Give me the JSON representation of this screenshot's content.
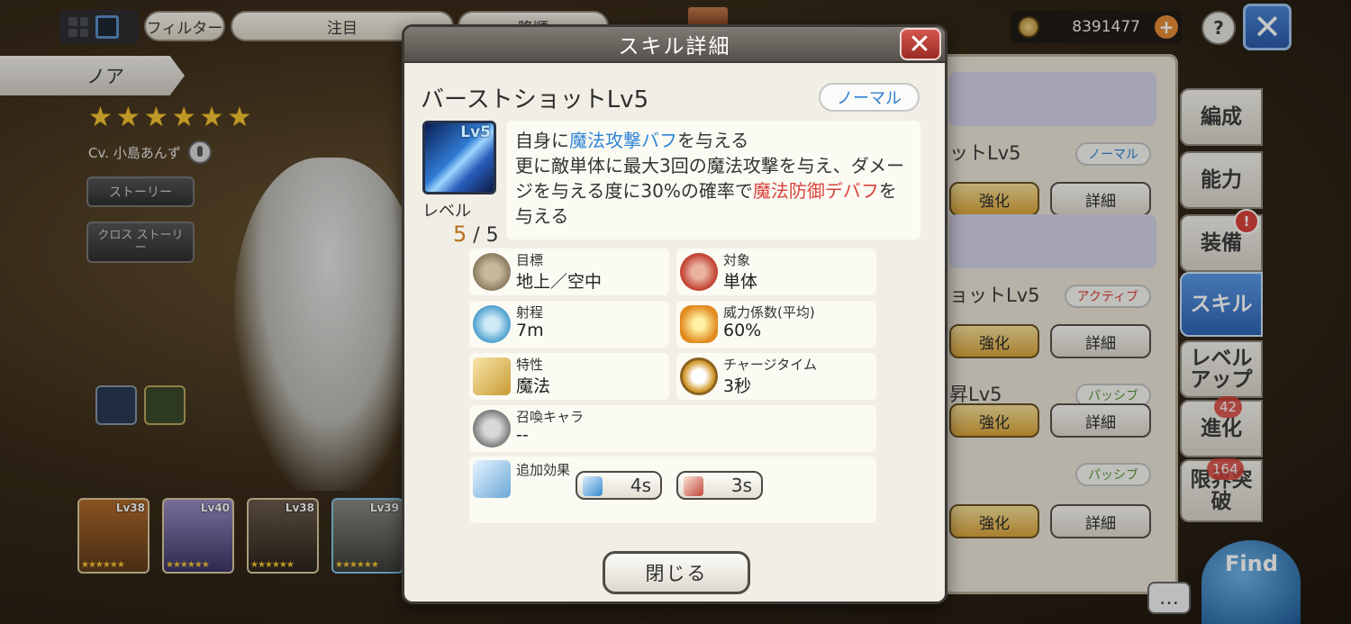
{
  "topbar": {
    "filter_label": "フィルター",
    "sort_value": "注目",
    "order_label": "降順",
    "currency_value": "8391477"
  },
  "character": {
    "name": "ノア",
    "rarity_stars": 6,
    "voice_actor": "Cv. 小島あんず",
    "story_label": "ストーリー",
    "cross_story_label": "クロス ストーリー"
  },
  "party": [
    {
      "level": "Lv38"
    },
    {
      "level": "Lv40"
    },
    {
      "level": "Lv38"
    },
    {
      "level": "Lv39"
    }
  ],
  "skill_list": [
    {
      "name_fragment": "ットLv5",
      "type": "ノーマル",
      "enhance": "強化",
      "detail": "詳細"
    },
    {
      "name_fragment": "ョットLv5",
      "type": "アクティブ",
      "enhance": "強化",
      "detail": "詳細"
    },
    {
      "name_fragment": "昇Lv5",
      "type": "パッシブ",
      "enhance": "強化",
      "detail": "詳細"
    },
    {
      "name_fragment": "",
      "type": "パッシブ",
      "enhance": "強化",
      "detail": "詳細"
    }
  ],
  "side_tabs": [
    "編成",
    "能力",
    "装備",
    "スキル",
    "レベルアップ",
    "進化",
    "限界突破"
  ],
  "badges": {
    "evolution_count": "42",
    "limit_break_count": "164"
  },
  "mascot_text": "Find",
  "dialog": {
    "header": "スキル詳細",
    "skill_name": "バーストショットLv5",
    "skill_type": "ノーマル",
    "icon_level": "Lv5",
    "level_label": "レベル",
    "level_current": "5",
    "level_max": " / 5",
    "description": {
      "p1": "自身に",
      "p2": "魔法攻撃バフ",
      "p3": "を与える",
      "p4": "更に敵単体に最大3回の魔法攻撃を与え、ダメージを与える度に30%の確率で",
      "p5": "魔法防御デバフ",
      "p6": "を与える"
    },
    "stats": {
      "target": {
        "label": "目標",
        "value": "地上／空中"
      },
      "scope": {
        "label": "対象",
        "value": "単体"
      },
      "range": {
        "label": "射程",
        "value": "7m"
      },
      "power": {
        "label": "威力係数(平均)",
        "value": "60%"
      },
      "attribute": {
        "label": "特性",
        "value": "魔法"
      },
      "charge": {
        "label": "チャージタイム",
        "value": "3秒"
      },
      "summon": {
        "label": "召喚キャラ",
        "value": "--"
      }
    },
    "extra": {
      "label": "追加効果",
      "effects": [
        {
          "duration": "4s",
          "icon": "magic-attack-buff-icon"
        },
        {
          "duration": "3s",
          "icon": "magic-defense-debuff-icon"
        }
      ]
    },
    "close_label": "閉じる"
  }
}
